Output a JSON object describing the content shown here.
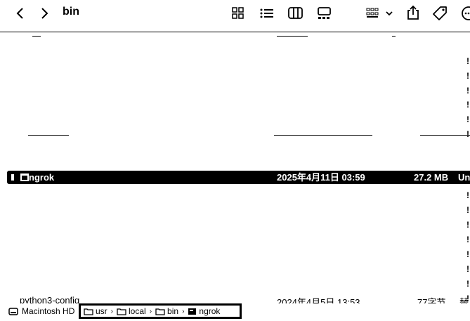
{
  "window": {
    "title": "bin"
  },
  "toolbar": {
    "back_icon": "chevron-left-icon",
    "forward_icon": "chevron-right-icon",
    "view_icons": [
      "icon-view-icon",
      "list-view-icon",
      "column-view-icon",
      "gallery-view-icon"
    ],
    "group_icon": "group-icon",
    "share_icon": "share-icon",
    "tag_icon": "tag-icon",
    "more_icon": "more-icon"
  },
  "list": {
    "selected_row": {
      "name": "ngrok",
      "date": "2025年4月11日 03:59",
      "size": "27.2 MB",
      "kind": "Un"
    },
    "bottom_row": {
      "name": "python3-config",
      "date": "2024年4月5日 13:53",
      "size": "77字节",
      "kind": "替"
    }
  },
  "pathbar": {
    "disk": "Macintosh HD",
    "crumbs": [
      "usr",
      "local",
      "bin",
      "ngrok"
    ]
  }
}
